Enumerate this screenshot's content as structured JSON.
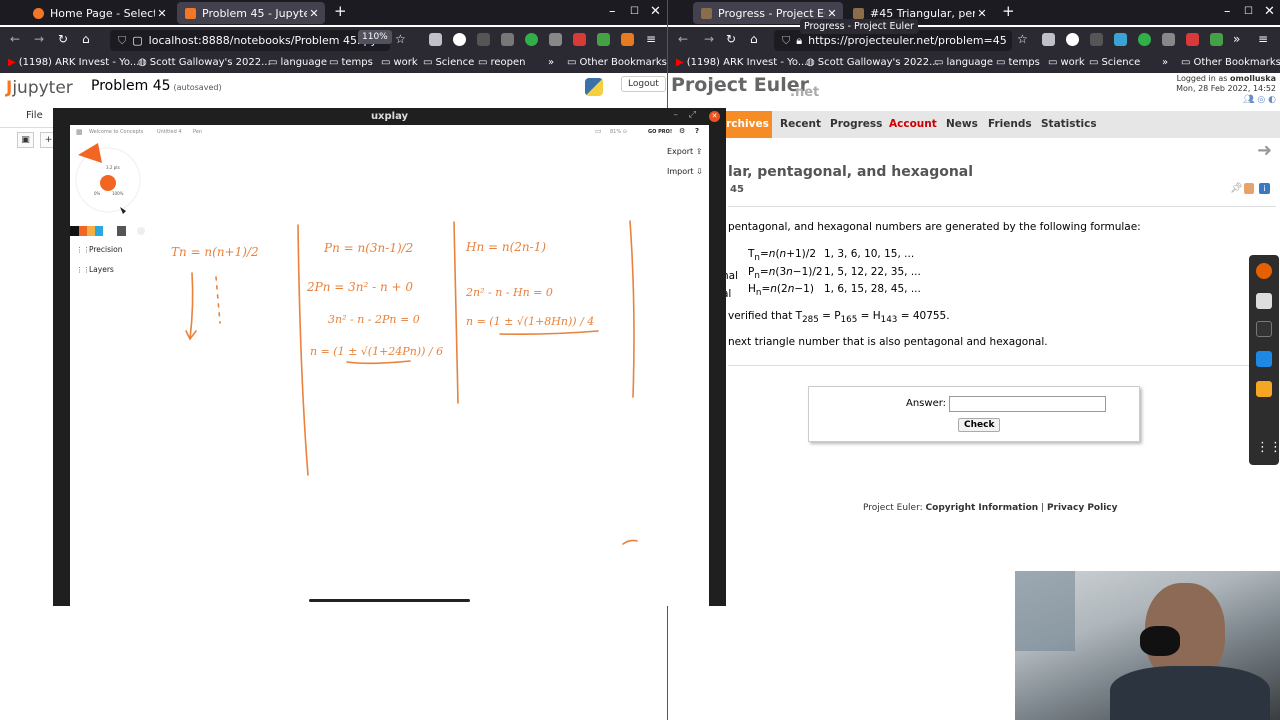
{
  "left_browser": {
    "tabs": [
      {
        "label": "Home Page - Select or cre",
        "color": "#f37726"
      },
      {
        "label": "Problem 45 - Jupyter Not",
        "color": "#f37726"
      }
    ],
    "url": "localhost:8888/notebooks/Problem 45.ipyn",
    "zoom": "110%",
    "bookmarks": [
      "(1198) ARK Invest - Yo...",
      "Scott Galloway's 2022...",
      "language",
      "temps",
      "work",
      "Science",
      "reopen"
    ],
    "other_bookmarks": "Other Bookmarks"
  },
  "jupyter": {
    "logo_pre": "J",
    "logo": "jupyter",
    "title": "Problem 45",
    "autosaved": "(autosaved)",
    "logout": "Logout",
    "menu_file": "File"
  },
  "uxplay": {
    "title": "uxplay",
    "canvas_tabs": [
      "Welcome to Concepts",
      "Untitled 4",
      "Pen"
    ],
    "canvas_status": "81% ⊙",
    "go_pro": "GO PRO!",
    "export": "Export",
    "import": "Import",
    "precision": "Precision",
    "layers": "Layers",
    "brush_size": "3.2 pts",
    "brush_opacity": "100%",
    "brush_zero": "0%",
    "brush_accent": "#f26522",
    "handwriting": {
      "col1_line1": "Tn = n(n+1)/2",
      "col2_line1": "Pn = n(3n-1)/2",
      "col2_line2": "2Pn = 3n² - n + 0",
      "col2_line3": "3n² - n - 2Pn = 0",
      "col2_line4": "n = (1 ± √(1+24Pn)) / 6",
      "col3_line1": "Hn = n(2n-1)",
      "col3_line2": "2n² - n - Hn = 0",
      "col3_line3": "n = (1 ± √(1+8Hn)) / 4",
      "ink_color": "#e8823c"
    }
  },
  "right_browser": {
    "tabs": [
      {
        "label": "Progress - Project Euler",
        "color": "#8a6e4b"
      },
      {
        "label": "#45 Triangular, pentagon",
        "color": "#8a6e4b"
      }
    ],
    "tooltip": "Progress - Project Euler",
    "url": "https://projecteuler.net/problem=45",
    "bookmarks": [
      "(1198) ARK Invest - Yo...",
      "Scott Galloway's 2022...",
      "language",
      "temps",
      "work",
      "Science"
    ],
    "other_bookmarks": "Other Bookmarks"
  },
  "euler": {
    "logo": "Project Euler",
    "logo_net": ".net",
    "logged_in": "Logged in as",
    "user": "omolluska",
    "date": "Mon, 28 Feb 2022, 14:52",
    "nav": [
      "Archives",
      "Recent",
      "Progress",
      "Account",
      "News",
      "Friends",
      "Statistics"
    ],
    "title": "lar, pentagonal, and hexagonal",
    "problem_id": "45",
    "intro": "pentagonal, and hexagonal numbers are generated by the following formulae:",
    "rows": [
      {
        "label": "",
        "formula_html": "T<sub>n</sub>=<i>n</i>(<i>n</i>+1)/2",
        "values": "1, 3, 6, 10, 15, ..."
      },
      {
        "label": "nal",
        "formula_html": "P<sub>n</sub>=<i>n</i>(3<i>n</i>−1)/2",
        "values": "1, 5, 12, 22, 35, ..."
      },
      {
        "label": "al",
        "formula_html": "H<sub>n</sub>=<i>n</i>(2<i>n</i>−1)",
        "values": "1, 6, 15, 28, 45, ..."
      }
    ],
    "verified_html": "verified that T<sub>285</sub> = P<sub>165</sub> = H<sub>143</sub> = 40755.",
    "question": "next triangle number that is also pentagonal and hexagonal.",
    "answer_label": "Answer:",
    "check": "Check",
    "footer_pre": "Project Euler: ",
    "footer_copyright": "Copyright Information",
    "footer_sep": " | ",
    "footer_privacy": "Privacy Policy"
  }
}
